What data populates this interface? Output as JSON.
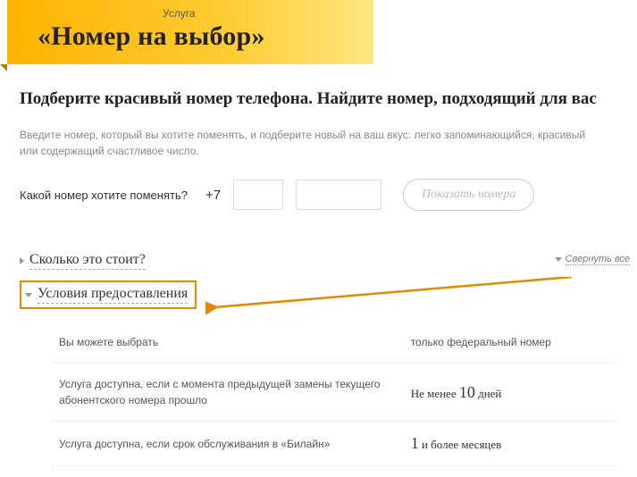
{
  "hero": {
    "service_label": "Услуга",
    "title": "«Номер на выбор»"
  },
  "main": {
    "headline": "Подберите красивый номер телефона. Найдите номер, подходящий для вас",
    "subtext": "Введите номер, который вы хотите поменять, и подберите новый на ваш вкус: легко запоминающийся, красивый или содержащий счастливое число.",
    "change_label": "Какой номер хотите поменять?",
    "prefix": "+7",
    "show_button": "Показать номера"
  },
  "accordion": {
    "collapse_all": "Свернуть все",
    "cost_title": "Сколько это стоит?",
    "conditions_title": "Условия предоставления",
    "conditions": [
      {
        "label": "Вы можете выбрать",
        "value": "только федеральный номер"
      },
      {
        "label": "Услуга доступна, если с момента предыдущей замены текущего абонентского номера прошло",
        "value_pre": "Не менее ",
        "value_num": "10",
        "value_post": " дней"
      },
      {
        "label": "Услуга доступна, если срок обслуживания в «Билайн»",
        "value_num": "1",
        "value_post": " и более месяцев"
      }
    ]
  }
}
